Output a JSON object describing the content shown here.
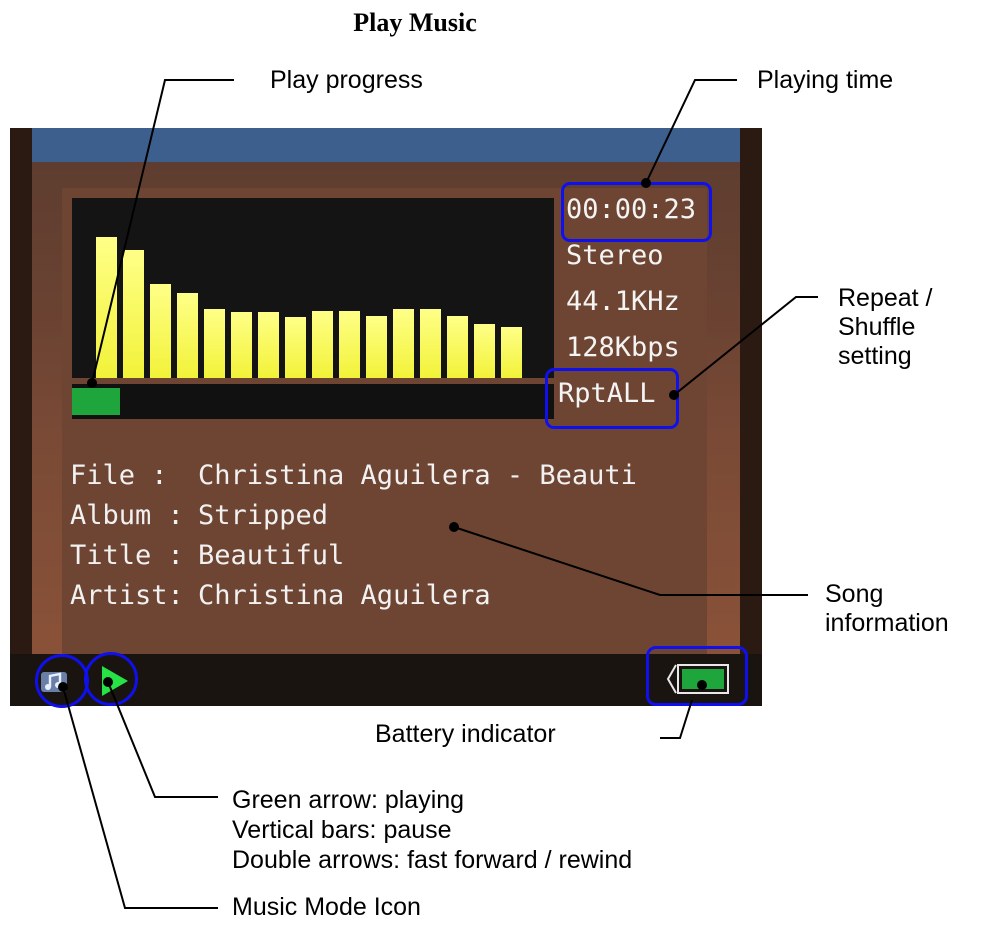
{
  "page_title": "Play Music",
  "labels": {
    "play_progress": "Play progress",
    "playing_time": "Playing time",
    "repeat_shuffle": [
      "Repeat /",
      "Shuffle",
      "setting"
    ],
    "song_information": [
      "Song",
      "information"
    ],
    "battery_indicator": "Battery indicator",
    "status_legend": [
      "Green arrow: playing",
      "Vertical bars: pause",
      "Double arrows: fast forward / rewind"
    ],
    "music_mode_icon": "Music Mode Icon"
  },
  "player": {
    "time": "00:00:23",
    "channel": "Stereo",
    "sample_rate": "44.1KHz",
    "bitrate": "128Kbps",
    "repeat_mode": "RptALL",
    "progress_fraction": 0.1,
    "spectrum_levels": [
      0.88,
      0.8,
      0.59,
      0.53,
      0.43,
      0.41,
      0.41,
      0.38,
      0.42,
      0.42,
      0.39,
      0.43,
      0.43,
      0.39,
      0.34,
      0.32
    ],
    "song": [
      {
        "label": "File  :",
        "value": "Christina Aguilera - Beauti"
      },
      {
        "label": "Album :",
        "value": "Stripped"
      },
      {
        "label": "Title :",
        "value": "Beautiful"
      },
      {
        "label": "Artist:",
        "value": "Christina Aguilera"
      }
    ]
  },
  "colors": {
    "spectrum_bar": "#f2f239",
    "progress_fill": "#1ea53b",
    "highlight_ring": "#1010ee",
    "title_bar": "#3d5f8e"
  },
  "icons": {
    "mode": "music-mode-icon",
    "status": "play-icon",
    "battery": "battery-icon"
  }
}
